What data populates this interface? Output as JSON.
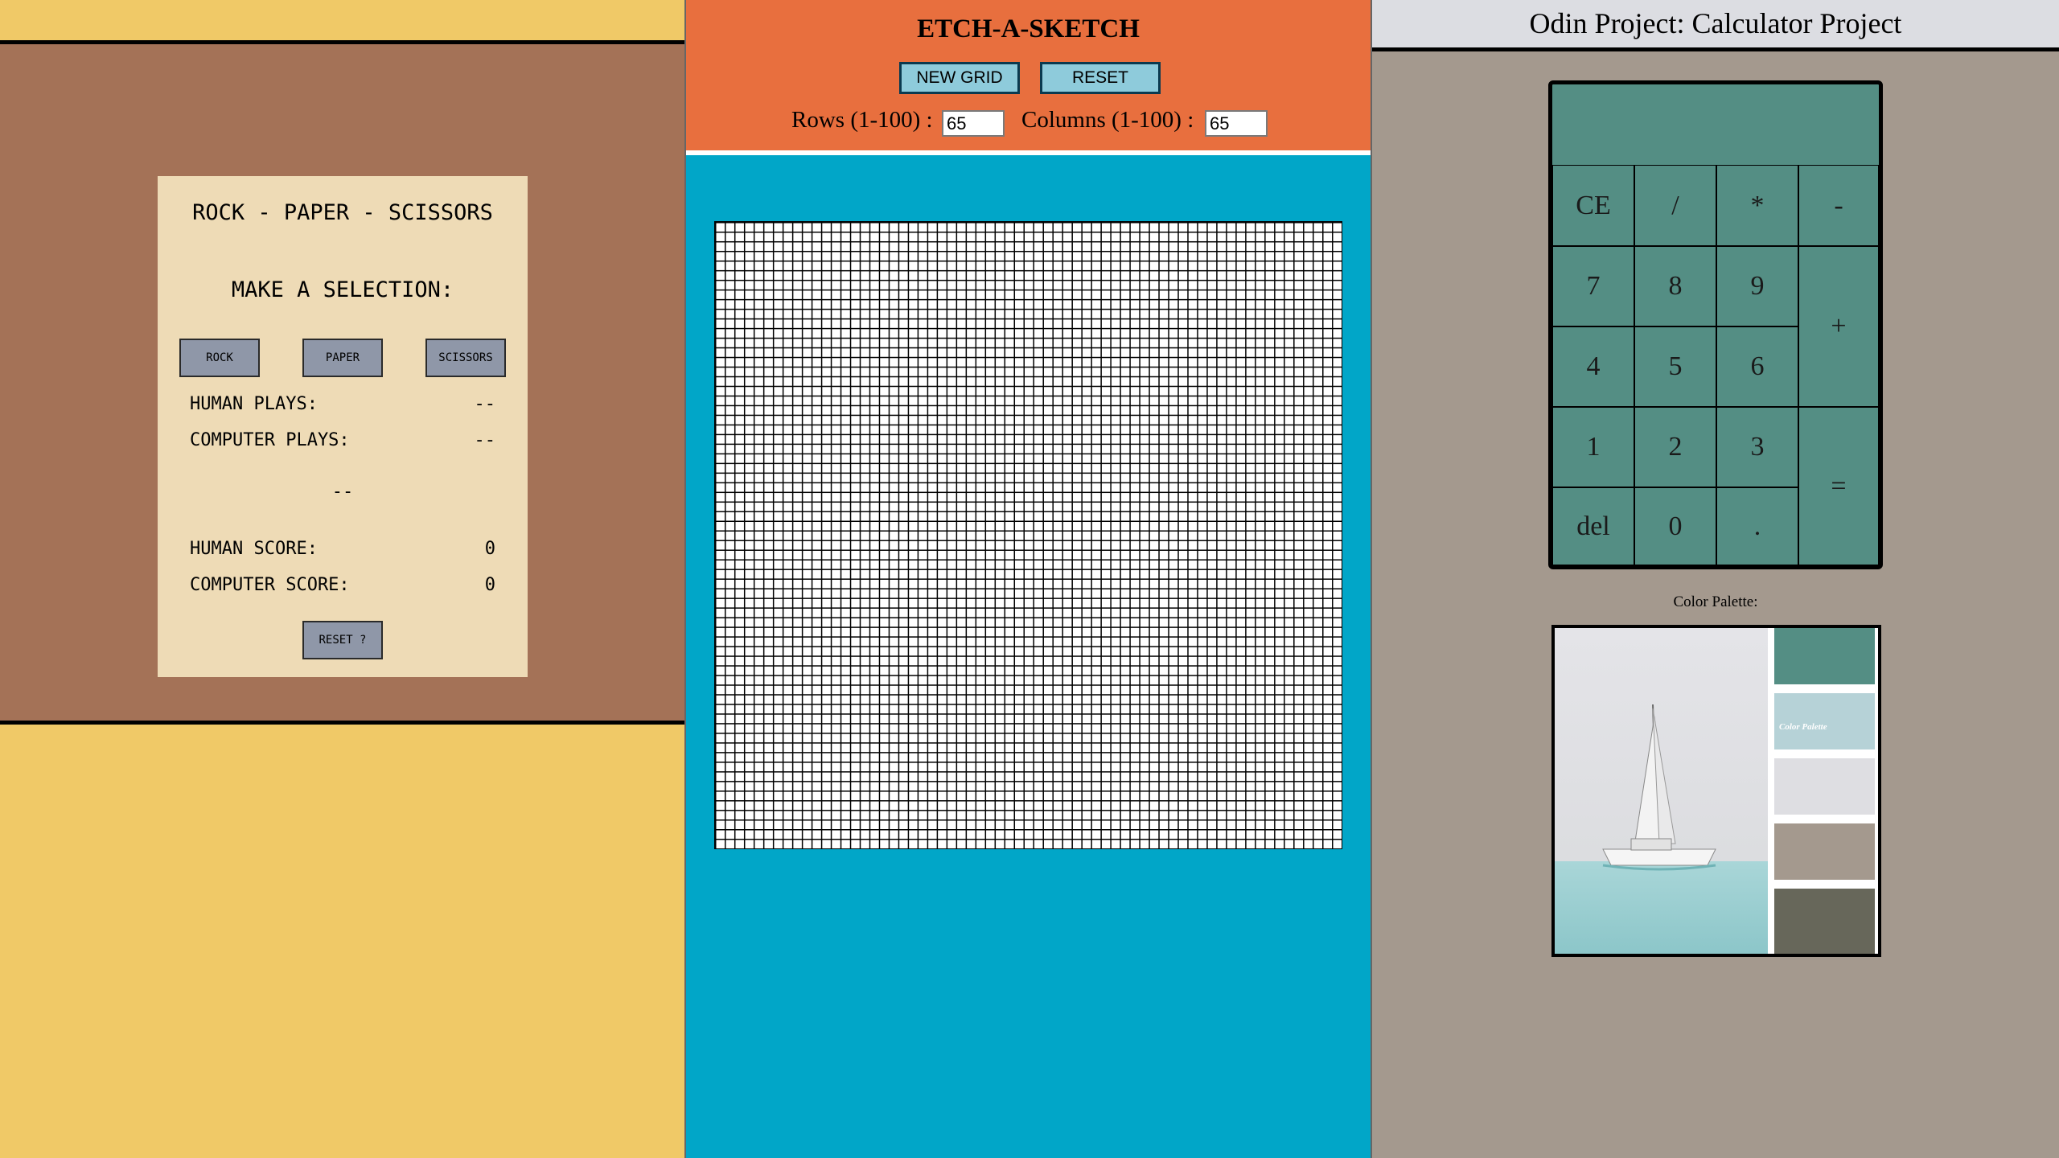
{
  "rps": {
    "title": "ROCK - PAPER - SCISSORS",
    "prompt": "MAKE A SELECTION:",
    "buttons": {
      "rock": "ROCK",
      "paper": "PAPER",
      "scissors": "SCISSORS"
    },
    "human_plays_label": "HUMAN PLAYS:",
    "human_plays_value": "--",
    "computer_plays_label": "COMPUTER PLAYS:",
    "computer_plays_value": "--",
    "result": "--",
    "human_score_label": "HUMAN SCORE:",
    "human_score_value": "0",
    "computer_score_label": "COMPUTER SCORE:",
    "computer_score_value": "0",
    "reset_label": "RESET ?"
  },
  "etch": {
    "title": "ETCH-A-SKETCH",
    "new_grid_label": "NEW GRID",
    "reset_label": "RESET",
    "rows_label": "Rows (1-100) :",
    "rows_value": "65",
    "cols_label": "Columns (1-100) :",
    "cols_value": "65"
  },
  "calc": {
    "title": "Odin Project: Calculator Project",
    "display": "",
    "keys": {
      "ce": "CE",
      "divide": "/",
      "multiply": "*",
      "minus": "-",
      "k7": "7",
      "k8": "8",
      "k9": "9",
      "plus": "+",
      "k4": "4",
      "k5": "5",
      "k6": "6",
      "k1": "1",
      "k2": "2",
      "k3": "3",
      "equals": "=",
      "del": "del",
      "k0": "0",
      "dot": "."
    },
    "palette_label": "Color Palette:",
    "palette_caption": "Color Palette",
    "swatch_colors": [
      "#548e84",
      "#b6d2d7",
      "#dedee2",
      "#a4998e",
      "#67675a"
    ]
  },
  "colors": {
    "rps_bg": "#f0c967",
    "rps_mid": "#a47257",
    "rps_card": "#eedbb6",
    "etch_header": "#e86f3e",
    "etch_bg": "#01a6c8",
    "calc_bg": "#a4998e",
    "calc_body": "#548e84"
  }
}
